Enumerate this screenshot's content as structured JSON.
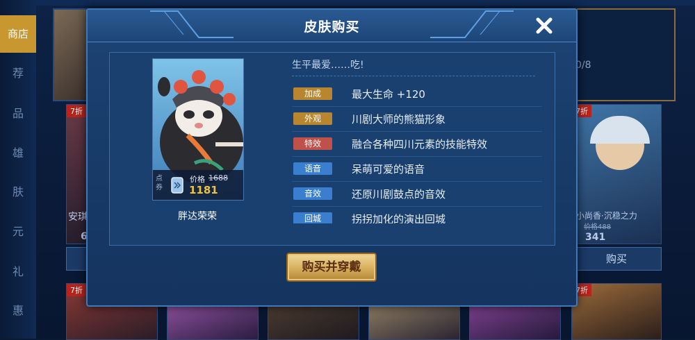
{
  "sidebar": {
    "items": [
      "商店",
      "荐",
      "品",
      "雄",
      "肤",
      "元",
      "礼",
      "惠"
    ]
  },
  "store": {
    "slot_count": "0/8",
    "left_card": {
      "tag": "7折",
      "name": "安琪",
      "price": "6"
    },
    "right_card": {
      "tag": "7折",
      "name": "小尚香·沉稳之力",
      "old_price": "价格488",
      "price": "341"
    },
    "bottom_tags": [
      "7折",
      "7折"
    ],
    "right_buy_label": "购买"
  },
  "modal": {
    "title": "皮肤购买",
    "skin": {
      "name": "胖达荣荣",
      "currency_label": "点券",
      "price_label": "价格",
      "old_price": "1688",
      "price": "1181"
    },
    "quote": "生平最爱……吃!",
    "features": [
      {
        "badge": "加成",
        "text": "最大生命 +120",
        "color": "#b8862f"
      },
      {
        "badge": "外观",
        "text": "川剧大师的熊猫形象",
        "color": "#b8862f"
      },
      {
        "badge": "特效",
        "text": "融合各种四川元素的技能特效",
        "color": "#c0514a"
      },
      {
        "badge": "语音",
        "text": "呆萌可爱的语音",
        "color": "#3a7fcf"
      },
      {
        "badge": "音效",
        "text": "还原川剧鼓点的音效",
        "color": "#3a7fcf"
      },
      {
        "badge": "回城",
        "text": "拐拐加化的演出回城",
        "color": "#3a7fcf"
      }
    ],
    "buy_button": "购买并穿戴"
  }
}
